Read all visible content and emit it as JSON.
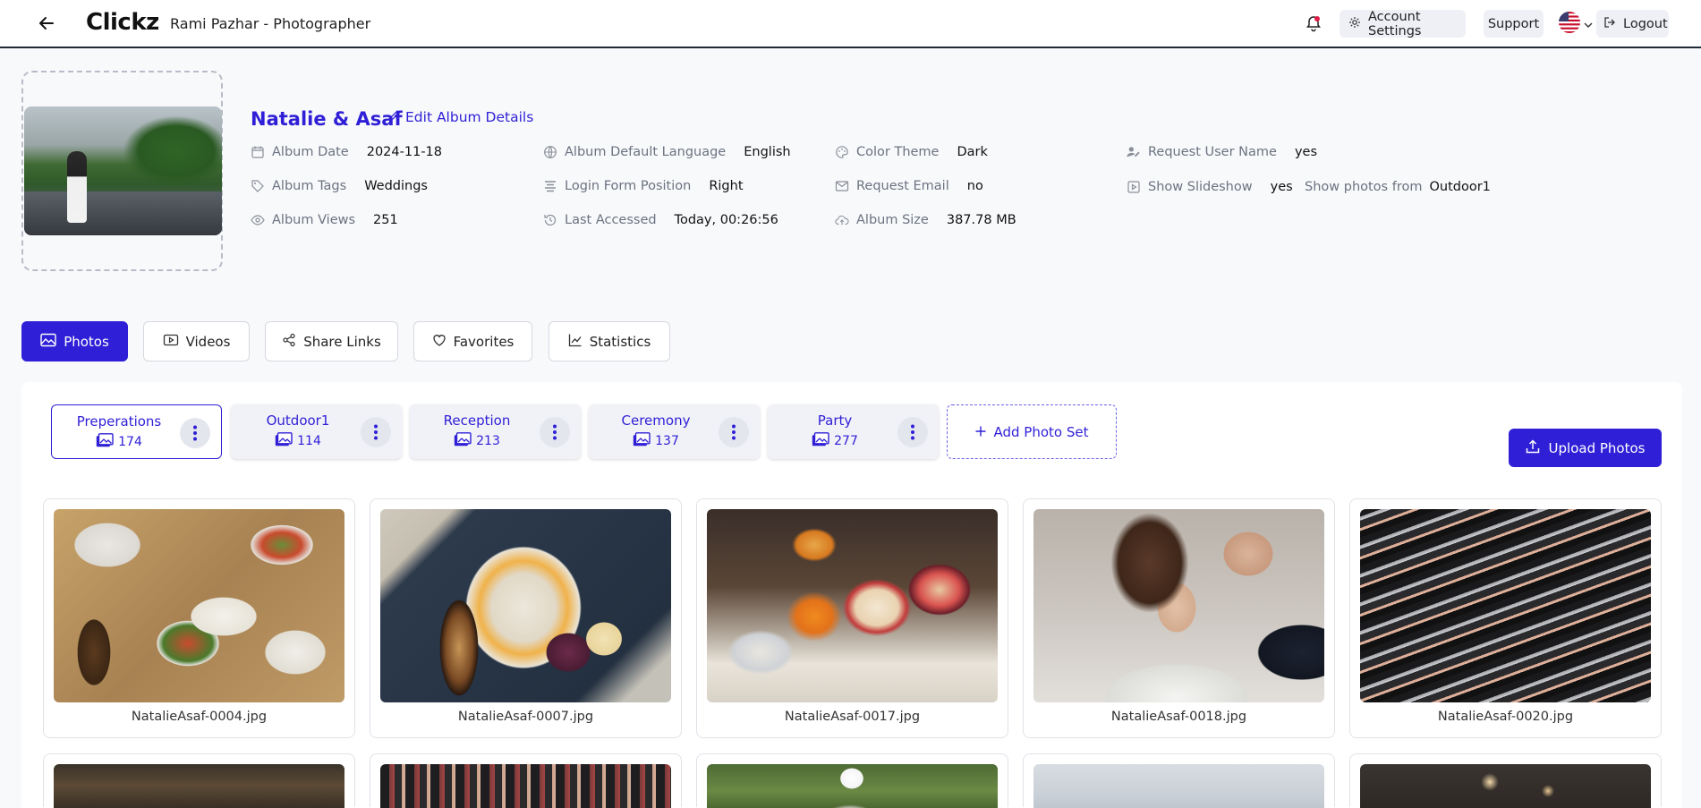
{
  "header": {
    "logo": "Clickz",
    "breadcrumb": "Rami Pazhar - Photographer",
    "account_settings": "Account Settings",
    "support": "Support",
    "logout": "Logout"
  },
  "album": {
    "title": "Natalie & Asaf",
    "edit_label": "Edit Album Details",
    "meta": {
      "date_label": "Album Date",
      "date_value": "2024-11-18",
      "tags_label": "Album Tags",
      "tags_value": "Weddings",
      "views_label": "Album Views",
      "views_value": "251",
      "lang_label": "Album Default Language",
      "lang_value": "English",
      "loginpos_label": "Login Form Position",
      "loginpos_value": "Right",
      "accessed_label": "Last Accessed",
      "accessed_value": "Today, 00:26:56",
      "theme_label": "Color Theme",
      "theme_value": "Dark",
      "email_label": "Request Email",
      "email_value": "no",
      "size_label": "Album Size",
      "size_value": "387.78 MB",
      "username_label": "Request User Name",
      "username_value": "yes",
      "slideshow_label": "Show Slideshow",
      "slideshow_value": "yes",
      "photosfrom_label": "Show photos from",
      "photosfrom_value": "Outdoor1"
    }
  },
  "tabs": [
    {
      "label": "Photos"
    },
    {
      "label": "Videos"
    },
    {
      "label": "Share Links"
    },
    {
      "label": "Favorites"
    },
    {
      "label": "Statistics"
    }
  ],
  "photo_sets": [
    {
      "name": "Preperations",
      "count": "174"
    },
    {
      "name": "Outdoor1",
      "count": "114"
    },
    {
      "name": "Reception",
      "count": "213"
    },
    {
      "name": "Ceremony",
      "count": "137"
    },
    {
      "name": "Party",
      "count": "277"
    }
  ],
  "add_photo_set": "Add Photo Set",
  "upload_photos": "Upload Photos",
  "photos": [
    {
      "filename": "NatalieAsaf-0004.jpg"
    },
    {
      "filename": "NatalieAsaf-0007.jpg"
    },
    {
      "filename": "NatalieAsaf-0017.jpg"
    },
    {
      "filename": "NatalieAsaf-0018.jpg"
    },
    {
      "filename": "NatalieAsaf-0020.jpg"
    }
  ],
  "colors": {
    "accent": "#2f1fd6",
    "bell": "#e11d48"
  }
}
